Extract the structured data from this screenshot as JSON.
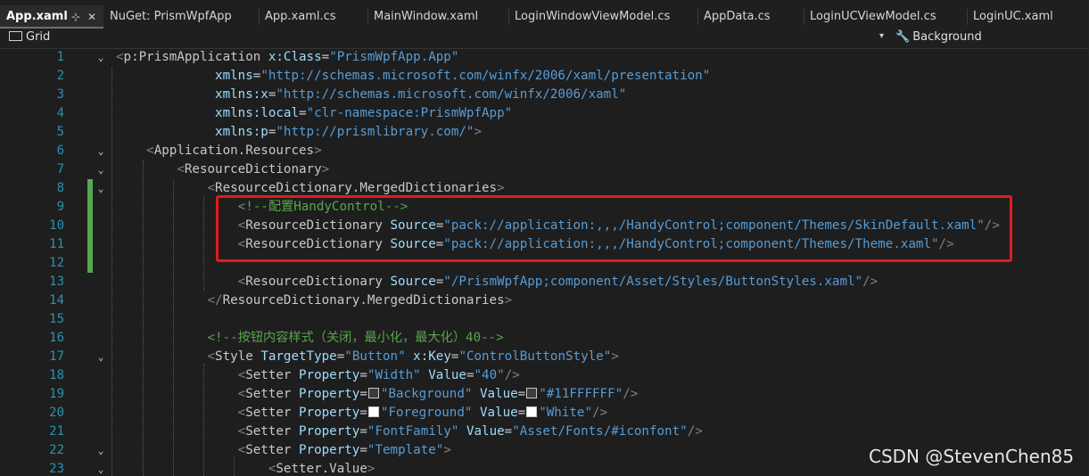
{
  "tabs": [
    {
      "label": "App.xaml",
      "active": true,
      "pin": "⊹",
      "close": "✕"
    },
    {
      "label": "NuGet: PrismWpfApp"
    },
    {
      "label": "App.xaml.cs"
    },
    {
      "label": "MainWindow.xaml"
    },
    {
      "label": "LoginWindowViewModel.cs"
    },
    {
      "label": "AppData.cs"
    },
    {
      "label": "LoginUCViewModel.cs"
    },
    {
      "label": "LoginUC.xaml"
    }
  ],
  "navbar": {
    "left": "Grid",
    "dropdown": "▾",
    "right": "Background"
  },
  "editor": {
    "lines": [
      {
        "n": "1",
        "text": "<p:PrismApplication x:Class=\"PrismWpfApp.App\""
      },
      {
        "n": "2",
        "text": "             xmlns=\"http://schemas.microsoft.com/winfx/2006/xaml/presentation\""
      },
      {
        "n": "3",
        "text": "             xmlns:x=\"http://schemas.microsoft.com/winfx/2006/xaml\""
      },
      {
        "n": "4",
        "text": "             xmlns:local=\"clr-namespace:PrismWpfApp\""
      },
      {
        "n": "5",
        "text": "             xmlns:p=\"http://prismlibrary.com/\">"
      },
      {
        "n": "6",
        "text": "    <Application.Resources>"
      },
      {
        "n": "7",
        "text": "        <ResourceDictionary>"
      },
      {
        "n": "8",
        "text": "            <ResourceDictionary.MergedDictionaries>"
      },
      {
        "n": "9",
        "text": "                <!--配置HandyControl-->"
      },
      {
        "n": "10",
        "text": "                <ResourceDictionary Source=\"pack://application:,,,/HandyControl;component/Themes/SkinDefault.xaml\"/>"
      },
      {
        "n": "11",
        "text": "                <ResourceDictionary Source=\"pack://application:,,,/HandyControl;component/Themes/Theme.xaml\"/>"
      },
      {
        "n": "12",
        "text": ""
      },
      {
        "n": "13",
        "text": "                <ResourceDictionary Source=\"/PrismWpfApp;component/Asset/Styles/ButtonStyles.xaml\"/>"
      },
      {
        "n": "14",
        "text": "            </ResourceDictionary.MergedDictionaries>"
      },
      {
        "n": "15",
        "text": ""
      },
      {
        "n": "16",
        "text": "            <!--按钮内容样式（关闭，最小化，最大化）40-->"
      },
      {
        "n": "17",
        "text": "            <Style TargetType=\"Button\" x:Key=\"ControlButtonStyle\">"
      },
      {
        "n": "18",
        "text": "                <Setter Property=\"Width\" Value=\"40\"/>"
      },
      {
        "n": "19",
        "text": "                <Setter Property=\"Background\" Value=\"#11FFFFFF\"/>"
      },
      {
        "n": "20",
        "text": "                <Setter Property=\"Foreground\" Value=\"White\"/>"
      },
      {
        "n": "21",
        "text": "                <Setter Property=\"FontFamily\" Value=\"Asset/Fonts/#iconfont\"/>"
      },
      {
        "n": "22",
        "text": "                <Setter Property=\"Template\">"
      },
      {
        "n": "23",
        "text": "                    <Setter.Value>"
      }
    ]
  },
  "watermark": "CSDN @StevenChen85",
  "colors": {
    "bracket": "#808080",
    "element": "#c8c8c8",
    "attribute": "#9cdcfe",
    "string": "#569cd6",
    "comment": "#57a64a",
    "line_number": "#2b91af",
    "highlight_box": "#e41b1b",
    "change_bar": "#55a84f"
  }
}
